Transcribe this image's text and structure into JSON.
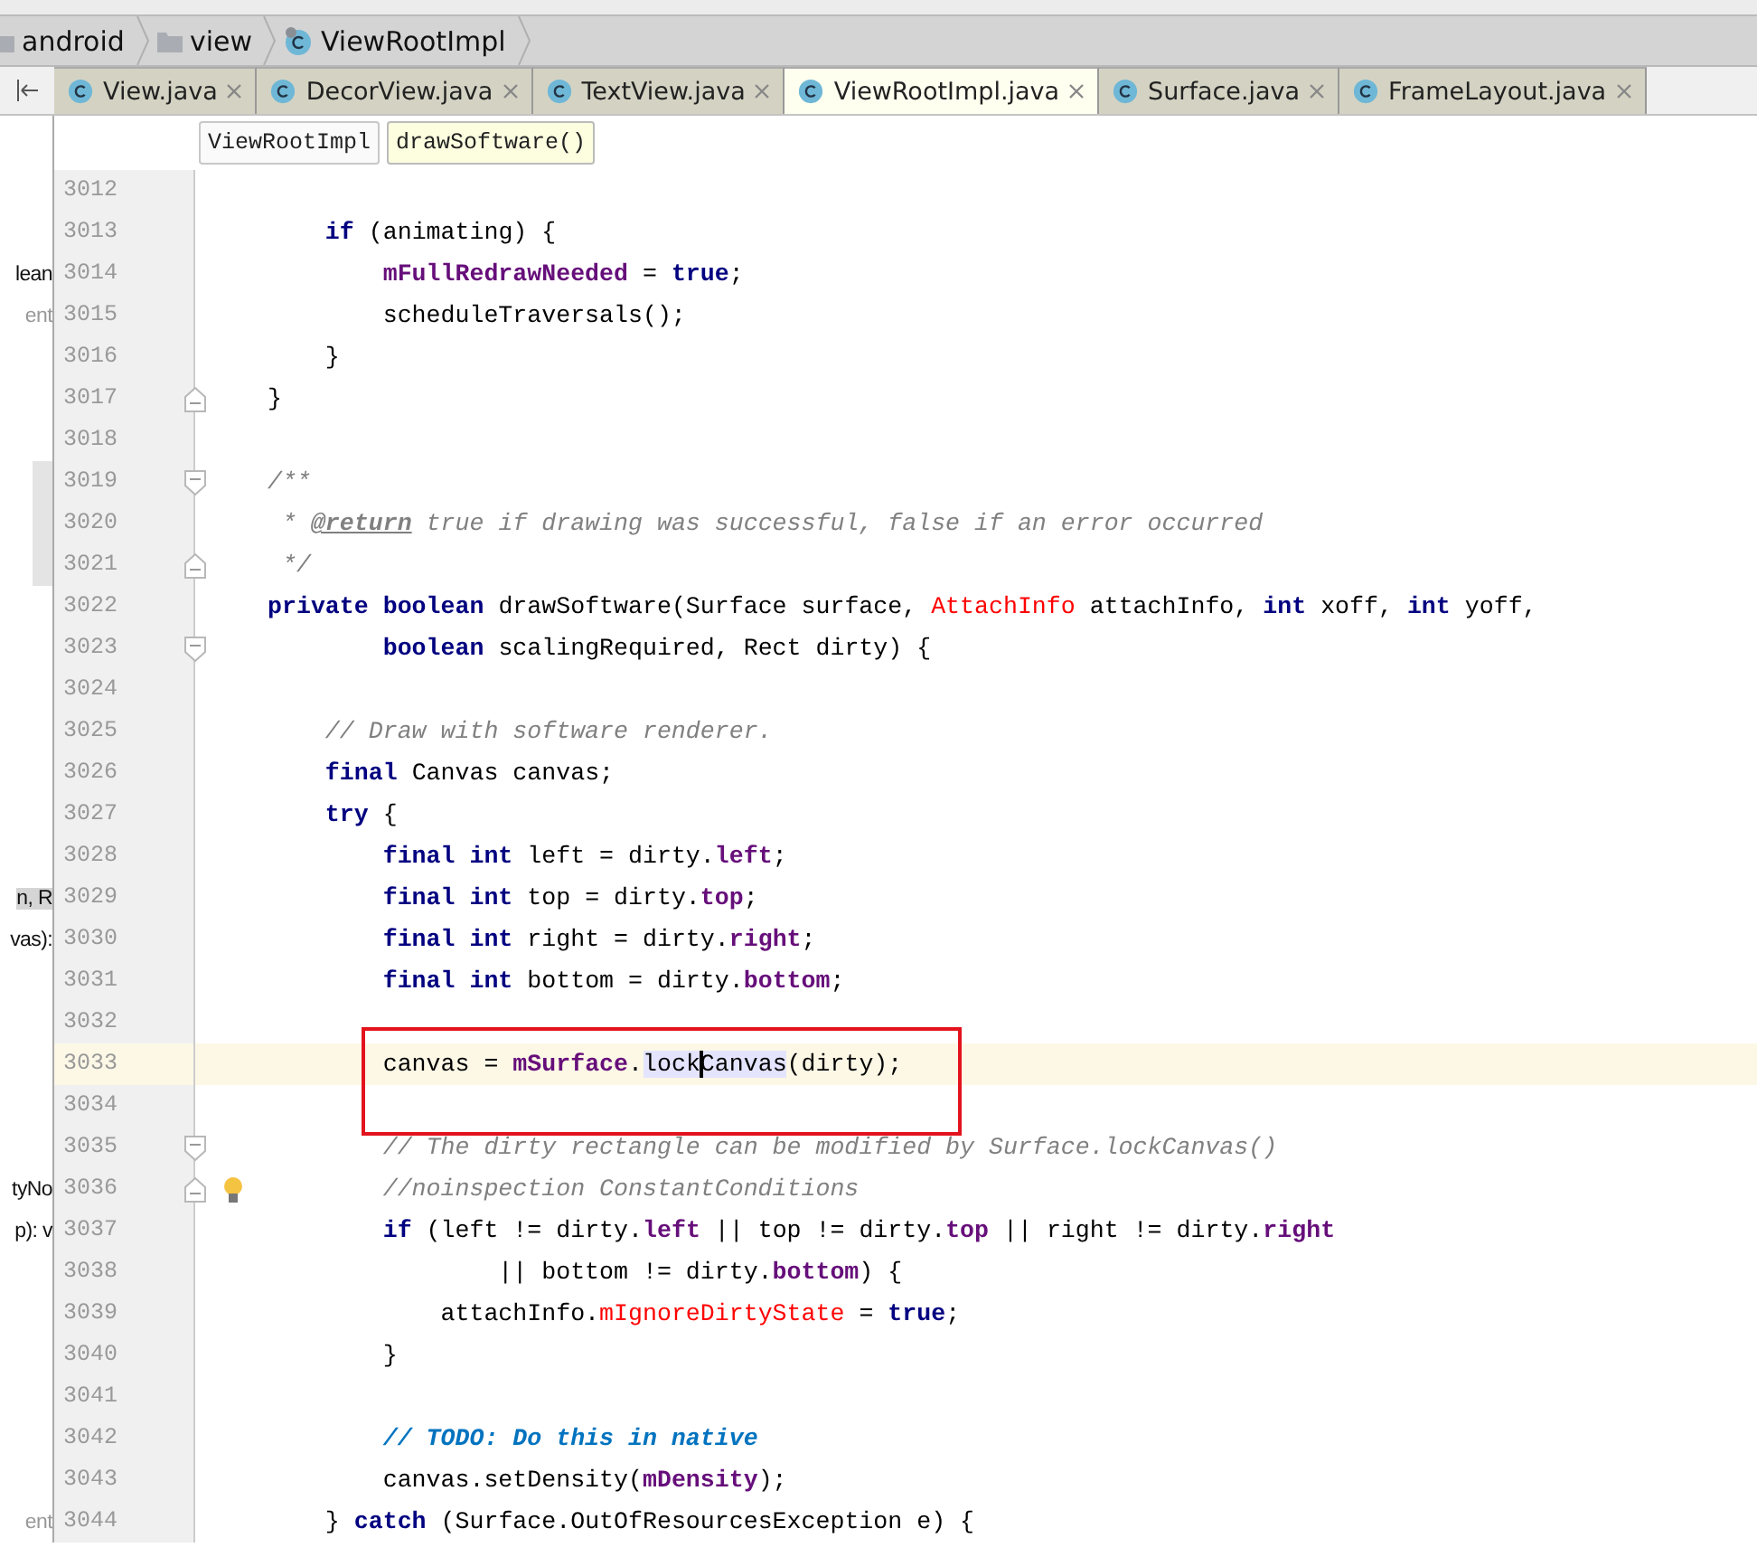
{
  "breadcrumbs": [
    {
      "text": "android",
      "kind": "folder"
    },
    {
      "text": "view",
      "kind": "folder"
    },
    {
      "text": "ViewRootImpl",
      "kind": "class"
    }
  ],
  "tabs": [
    {
      "label": "View.java",
      "selected": false
    },
    {
      "label": "DecorView.java",
      "selected": false
    },
    {
      "label": "TextView.java",
      "selected": false
    },
    {
      "label": "ViewRootImpl.java",
      "selected": true
    },
    {
      "label": "Surface.java",
      "selected": false
    },
    {
      "label": "FrameLayout.java",
      "selected": false
    }
  ],
  "method_breadcrumbs": [
    {
      "text": "ViewRootImpl",
      "selected": false
    },
    {
      "text": "drawSoftware()",
      "selected": true
    }
  ],
  "side_panel": [
    {
      "kind": "gap"
    },
    {
      "kind": "gap"
    },
    {
      "kind": "text",
      "text": "lean"
    },
    {
      "kind": "muted",
      "text": "ent"
    },
    {
      "kind": "gap"
    },
    {
      "kind": "gap"
    },
    {
      "kind": "gap"
    },
    {
      "kind": "block"
    },
    {
      "kind": "block"
    },
    {
      "kind": "block"
    },
    {
      "kind": "gap"
    },
    {
      "kind": "gap"
    },
    {
      "kind": "gap"
    },
    {
      "kind": "gap"
    },
    {
      "kind": "gap"
    },
    {
      "kind": "gap"
    },
    {
      "kind": "gap"
    },
    {
      "kind": "selected",
      "text": "n, R"
    },
    {
      "kind": "text",
      "text": "vas):"
    },
    {
      "kind": "gap"
    },
    {
      "kind": "gap"
    },
    {
      "kind": "gap"
    },
    {
      "kind": "gap"
    },
    {
      "kind": "gap"
    },
    {
      "kind": "text",
      "text": "tyNo"
    },
    {
      "kind": "text",
      "text": "p): v"
    },
    {
      "kind": "gap"
    },
    {
      "kind": "gap"
    },
    {
      "kind": "gap"
    },
    {
      "kind": "gap"
    },
    {
      "kind": "gap"
    },
    {
      "kind": "gap"
    },
    {
      "kind": "muted",
      "text": "ent"
    }
  ],
  "code_lines": [
    {
      "number": "3012"
    },
    {
      "number": "3013",
      "tokens": [
        {
          "kind": "kw",
          "text": "    if"
        },
        {
          "kind": "plain",
          "text": " (animating) {"
        }
      ]
    },
    {
      "number": "3014",
      "tokens": [
        {
          "kind": "field",
          "text": "        mFullRedrawNeeded"
        },
        {
          "kind": "plain",
          "text": " = "
        },
        {
          "kind": "kw",
          "text": "true"
        },
        {
          "kind": "plain",
          "text": ";"
        }
      ]
    },
    {
      "number": "3015",
      "tokens": [
        {
          "kind": "plain",
          "text": "        scheduleTraversals();"
        }
      ]
    },
    {
      "number": "3016",
      "tokens": [
        {
          "kind": "plain",
          "text": "    }"
        }
      ]
    },
    {
      "number": "3017",
      "fold_end": true,
      "tokens": [
        {
          "kind": "plain",
          "text": "}"
        }
      ]
    },
    {
      "number": "3018"
    },
    {
      "number": "3019",
      "fold_start": true,
      "tokens": [
        {
          "kind": "comment",
          "text": "/**"
        }
      ]
    },
    {
      "number": "3020",
      "tokens": [
        {
          "kind": "comment",
          "text": " *"
        },
        {
          "kind": "doctag",
          "text": " @return"
        },
        {
          "kind": "comment",
          "text": " true if drawing was successful, false if an error occurred"
        }
      ]
    },
    {
      "number": "3021",
      "fold_end": true,
      "tokens": [
        {
          "kind": "comment",
          "text": " */"
        }
      ]
    },
    {
      "number": "3022",
      "tokens": [
        {
          "kind": "kw",
          "text": "private boolean"
        },
        {
          "kind": "plain",
          "text": " drawSoftware(Surface surface, "
        },
        {
          "kind": "red",
          "text": "AttachInfo"
        },
        {
          "kind": "plain",
          "text": " attachInfo, "
        },
        {
          "kind": "kw",
          "text": "int"
        },
        {
          "kind": "plain",
          "text": " xoff, "
        },
        {
          "kind": "kw",
          "text": "int"
        },
        {
          "kind": "plain",
          "text": " yoff,"
        }
      ]
    },
    {
      "number": "3023",
      "fold_start": true,
      "tokens": [
        {
          "kind": "kw",
          "text": "        boolean"
        },
        {
          "kind": "plain",
          "text": " scalingRequired, Rect dirty) {"
        }
      ]
    },
    {
      "number": "3024"
    },
    {
      "number": "3025",
      "tokens": [
        {
          "kind": "comment",
          "text": "    // Draw with software renderer."
        }
      ]
    },
    {
      "number": "3026",
      "tokens": [
        {
          "kind": "kw",
          "text": "    final"
        },
        {
          "kind": "plain",
          "text": " Canvas canvas;"
        }
      ]
    },
    {
      "number": "3027",
      "tokens": [
        {
          "kind": "kw",
          "text": "    try"
        },
        {
          "kind": "plain",
          "text": " {"
        }
      ]
    },
    {
      "number": "3028",
      "tokens": [
        {
          "kind": "kw",
          "text": "        final int"
        },
        {
          "kind": "plain",
          "text": " left = dirty."
        },
        {
          "kind": "field",
          "text": "left"
        },
        {
          "kind": "plain",
          "text": ";"
        }
      ]
    },
    {
      "number": "3029",
      "tokens": [
        {
          "kind": "kw",
          "text": "        final int"
        },
        {
          "kind": "plain",
          "text": " top = dirty."
        },
        {
          "kind": "field",
          "text": "top"
        },
        {
          "kind": "plain",
          "text": ";"
        }
      ]
    },
    {
      "number": "3030",
      "tokens": [
        {
          "kind": "kw",
          "text": "        final int"
        },
        {
          "kind": "plain",
          "text": " right = dirty."
        },
        {
          "kind": "field",
          "text": "right"
        },
        {
          "kind": "plain",
          "text": ";"
        }
      ]
    },
    {
      "number": "3031",
      "tokens": [
        {
          "kind": "kw",
          "text": "        final int"
        },
        {
          "kind": "plain",
          "text": " bottom = dirty."
        },
        {
          "kind": "field",
          "text": "bottom"
        },
        {
          "kind": "plain",
          "text": ";"
        }
      ]
    },
    {
      "number": "3032"
    },
    {
      "number": "3033",
      "current": true,
      "annotated": true,
      "tokens": [
        {
          "kind": "plain",
          "text": "        canvas = "
        },
        {
          "kind": "field",
          "text": "mSurface"
        },
        {
          "kind": "plain",
          "text": "."
        },
        {
          "kind": "usage",
          "text": "lockCanvas",
          "caret": true
        },
        {
          "kind": "plain",
          "text": "(dirty);"
        }
      ]
    },
    {
      "number": "3034"
    },
    {
      "number": "3035",
      "fold_start": true,
      "tokens": [
        {
          "kind": "comment",
          "text": "        // The dirty rectangle can be modified by Surface.lockCanvas()"
        }
      ]
    },
    {
      "number": "3036",
      "fold_end": true,
      "bulb": true,
      "tokens": [
        {
          "kind": "comment",
          "text": "        //noinspection ConstantConditions"
        }
      ]
    },
    {
      "number": "3037",
      "tokens": [
        {
          "kind": "kw",
          "text": "        if"
        },
        {
          "kind": "plain",
          "text": " (left != dirty."
        },
        {
          "kind": "field",
          "text": "left"
        },
        {
          "kind": "plain",
          "text": " || top != dirty."
        },
        {
          "kind": "field",
          "text": "top"
        },
        {
          "kind": "plain",
          "text": " || right != dirty."
        },
        {
          "kind": "field",
          "text": "right"
        }
      ]
    },
    {
      "number": "3038",
      "tokens": [
        {
          "kind": "plain",
          "text": "                || bottom != dirty."
        },
        {
          "kind": "field",
          "text": "bottom"
        },
        {
          "kind": "plain",
          "text": ") {"
        }
      ]
    },
    {
      "number": "3039",
      "tokens": [
        {
          "kind": "plain",
          "text": "            attachInfo."
        },
        {
          "kind": "red",
          "text": "mIgnoreDirtyState"
        },
        {
          "kind": "plain",
          "text": " = "
        },
        {
          "kind": "kw",
          "text": "true"
        },
        {
          "kind": "plain",
          "text": ";"
        }
      ]
    },
    {
      "number": "3040",
      "tokens": [
        {
          "kind": "plain",
          "text": "        }"
        }
      ]
    },
    {
      "number": "3041"
    },
    {
      "number": "3042",
      "tokens": [
        {
          "kind": "todo",
          "text": "        // TODO: Do this in native"
        }
      ]
    },
    {
      "number": "3043",
      "tokens": [
        {
          "kind": "plain",
          "text": "        canvas.setDensity("
        },
        {
          "kind": "field",
          "text": "mDensity"
        },
        {
          "kind": "plain",
          "text": ");"
        }
      ]
    },
    {
      "number": "3044",
      "tokens": [
        {
          "kind": "plain",
          "text": "    } "
        },
        {
          "kind": "kw",
          "text": "catch"
        },
        {
          "kind": "plain",
          "text": " (Surface.OutOfResourcesException e) {"
        }
      ]
    }
  ]
}
